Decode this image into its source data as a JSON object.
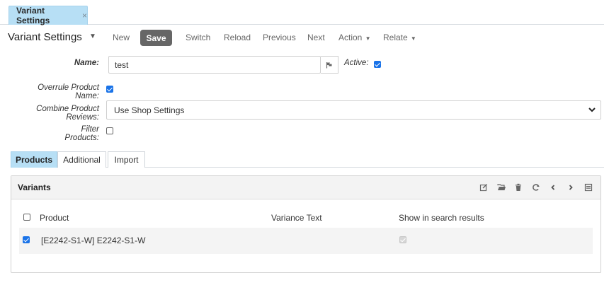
{
  "doc_tab": {
    "label": "Variant Settings",
    "close": "×"
  },
  "toolbar": {
    "title": "Variant Settings",
    "new": "New",
    "save": "Save",
    "switch": "Switch",
    "reload": "Reload",
    "previous": "Previous",
    "next": "Next",
    "action": "Action",
    "relate": "Relate"
  },
  "form": {
    "name_label": "Name:",
    "name_value": "test",
    "active_label": "Active:",
    "active_checked": true,
    "overrule_label": "Overrule Product Name:",
    "overrule_checked": true,
    "combine_label": "Combine Product Reviews:",
    "combine_value": "Use Shop Settings",
    "filter_label": "Filter Products:",
    "filter_checked": false
  },
  "tabs": [
    {
      "label": "Products",
      "active": true
    },
    {
      "label": "Additional",
      "active": false
    },
    {
      "label": "Import",
      "active": false
    }
  ],
  "panel": {
    "title": "Variants",
    "icons": [
      "edit-icon",
      "folder-open-icon",
      "trash-icon",
      "refresh-icon",
      "chevron-left-icon",
      "chevron-right-icon",
      "list-icon"
    ],
    "columns": [
      "Product",
      "Variance Text",
      "Show in search results"
    ],
    "rows": [
      {
        "selected": true,
        "product": "[E2242-S1-W] E2242-S1-W",
        "variance_text": "",
        "show_in_search": true
      }
    ]
  },
  "colors": {
    "accent_tab": "#b7dff5",
    "save_button": "#666666",
    "checkbox": "#1a73e8"
  }
}
